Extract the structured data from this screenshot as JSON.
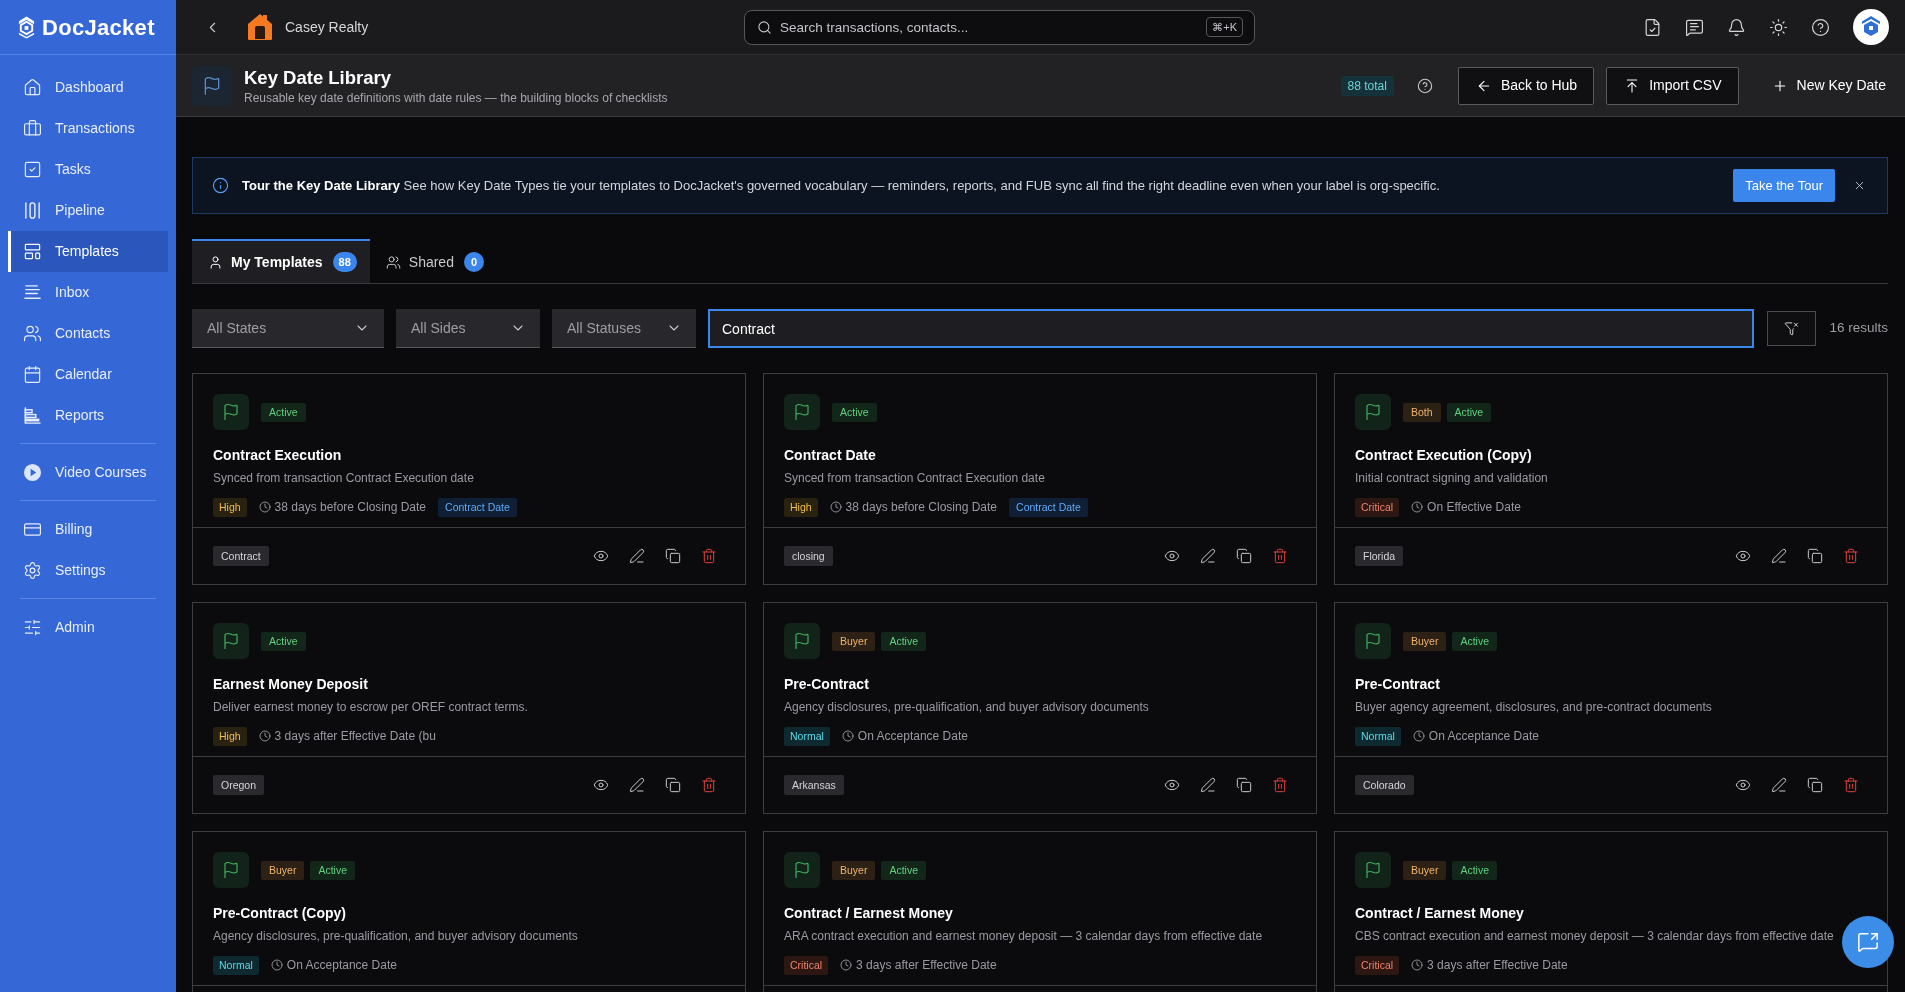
{
  "sidebar": {
    "logo": "DocJacket",
    "groups": [
      {
        "items": [
          {
            "label": "Dashboard",
            "selected": false
          },
          {
            "label": "Transactions",
            "selected": false
          },
          {
            "label": "Tasks",
            "selected": false
          },
          {
            "label": "Pipeline",
            "selected": false
          },
          {
            "label": "Templates",
            "selected": true
          },
          {
            "label": "Inbox",
            "selected": false
          },
          {
            "label": "Contacts",
            "selected": false
          },
          {
            "label": "Calendar",
            "selected": false
          },
          {
            "label": "Reports",
            "selected": false
          }
        ]
      },
      {
        "items": [
          {
            "label": "Video Courses",
            "selected": false
          }
        ]
      },
      {
        "items": [
          {
            "label": "Billing",
            "selected": false
          },
          {
            "label": "Settings",
            "selected": false
          }
        ]
      },
      {
        "items": [
          {
            "label": "Admin",
            "selected": false
          }
        ]
      }
    ]
  },
  "topbar": {
    "org_name": "Casey Realty",
    "search": {
      "placeholder": "Search transactions, contacts...",
      "shortcut": "⌘+K"
    }
  },
  "header": {
    "title": "Key Date Library",
    "subtitle": "Reusable key date definitions with date rules — the building blocks of checklists",
    "total": "88 total",
    "buttons": [
      {
        "label": "Back to Hub",
        "kind": "outline"
      },
      {
        "label": "Import CSV",
        "kind": "outline"
      },
      {
        "label": "New Key Date",
        "kind": "ghost"
      }
    ]
  },
  "banner": {
    "message": "**Tour the Key Date Library** See how Key Date Types tie your templates to DocJacket's governed vocabulary — reminders, reports, and FUB sync all find the right deadline even when your label is org-specific.",
    "button": "Take the Tour"
  },
  "tabs": [
    {
      "label": "My Templates",
      "count": "88",
      "selected": true
    },
    {
      "label": "Shared",
      "count": "0",
      "selected": false
    }
  ],
  "filters": {
    "dropdowns": [
      {
        "value": "All States"
      },
      {
        "value": "All Sides"
      },
      {
        "value": "All Statuses"
      }
    ],
    "search": {
      "value": "Contract"
    },
    "results": "16 results"
  },
  "cards": [
    {
      "badges": [
        {
          "label": "Active",
          "kind": "status"
        }
      ],
      "title": "Contract Execution",
      "description": "Synced from transaction Contract Execution date",
      "priority": {
        "label": "High",
        "kind": "high"
      },
      "rule": "38 days before Closing Date",
      "date_type": "Contract Date",
      "tag": "Contract"
    },
    {
      "badges": [
        {
          "label": "Active",
          "kind": "status"
        }
      ],
      "title": "Contract Date",
      "description": "Synced from transaction Contract Execution date",
      "priority": {
        "label": "High",
        "kind": "high"
      },
      "rule": "38 days before Closing Date",
      "date_type": "Contract Date",
      "tag": "closing"
    },
    {
      "badges": [
        {
          "label": "Both",
          "kind": "side"
        },
        {
          "label": "Active",
          "kind": "status"
        }
      ],
      "title": "Contract Execution (Copy)",
      "description": "Initial contract signing and validation",
      "priority": {
        "label": "Critical",
        "kind": "critical"
      },
      "rule": "On Effective Date",
      "tag": "Florida"
    },
    {
      "badges": [
        {
          "label": "Active",
          "kind": "status"
        }
      ],
      "title": "Earnest Money Deposit",
      "description": "Deliver earnest money to escrow per OREF contract terms.",
      "priority": {
        "label": "High",
        "kind": "high"
      },
      "rule": "3 days after Effective Date (bu",
      "tag": "Oregon"
    },
    {
      "badges": [
        {
          "label": "Buyer",
          "kind": "side"
        },
        {
          "label": "Active",
          "kind": "status"
        }
      ],
      "title": "Pre-Contract",
      "description": "Agency disclosures, pre-qualification, and buyer advisory documents",
      "priority": {
        "label": "Normal",
        "kind": "normal"
      },
      "rule": "On Acceptance Date",
      "tag": "Arkansas"
    },
    {
      "badges": [
        {
          "label": "Buyer",
          "kind": "side"
        },
        {
          "label": "Active",
          "kind": "status"
        }
      ],
      "title": "Pre-Contract",
      "description": "Buyer agency agreement, disclosures, and pre-contract documents",
      "priority": {
        "label": "Normal",
        "kind": "normal"
      },
      "rule": "On Acceptance Date",
      "tag": "Colorado"
    },
    {
      "badges": [
        {
          "label": "Buyer",
          "kind": "side"
        },
        {
          "label": "Active",
          "kind": "status"
        }
      ],
      "title": "Pre-Contract (Copy)",
      "description": "Agency disclosures, pre-qualification, and buyer advisory documents",
      "priority": {
        "label": "Normal",
        "kind": "normal"
      },
      "rule": "On Acceptance Date"
    },
    {
      "badges": [
        {
          "label": "Buyer",
          "kind": "side"
        },
        {
          "label": "Active",
          "kind": "status"
        }
      ],
      "title": "Contract / Earnest Money",
      "description": "ARA contract execution and earnest money deposit — 3 calendar days from effective date",
      "priority": {
        "label": "Critical",
        "kind": "critical"
      },
      "rule": "3 days after Effective Date"
    },
    {
      "badges": [
        {
          "label": "Buyer",
          "kind": "side"
        },
        {
          "label": "Active",
          "kind": "status"
        }
      ],
      "title": "Contract / Earnest Money",
      "description": "CBS contract execution and earnest money deposit — 3 calendar days from effective date",
      "priority": {
        "label": "Critical",
        "kind": "critical"
      },
      "rule": "3 days after Effective Date"
    }
  ]
}
